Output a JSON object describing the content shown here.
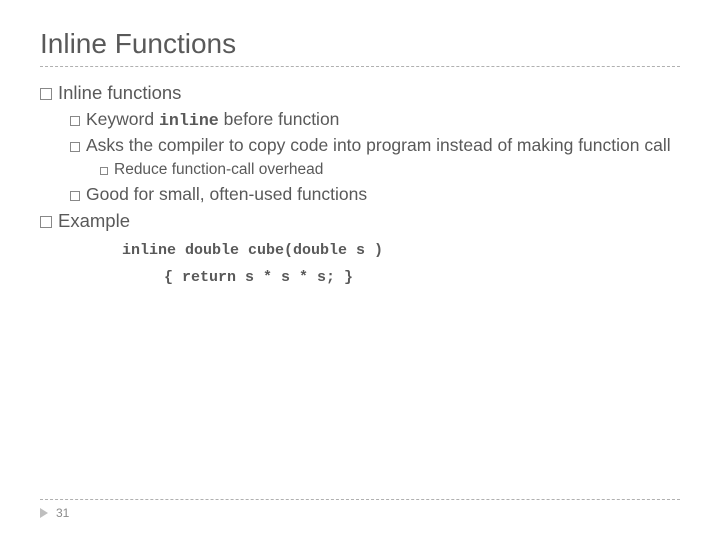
{
  "title": "Inline Functions",
  "bullets": {
    "b1": "Inline functions",
    "b1a_pre": "Keyword ",
    "b1a_code": "inline",
    "b1a_post": " before function",
    "b1b": "Asks the compiler to copy code into program instead of making function call",
    "b1b1": "Reduce function-call overhead",
    "b1c": "Good for small, often-used functions",
    "b2": "Example",
    "code1": "inline double cube(double s )",
    "code2": "{ return s * s * s; }"
  },
  "page_number": "31"
}
